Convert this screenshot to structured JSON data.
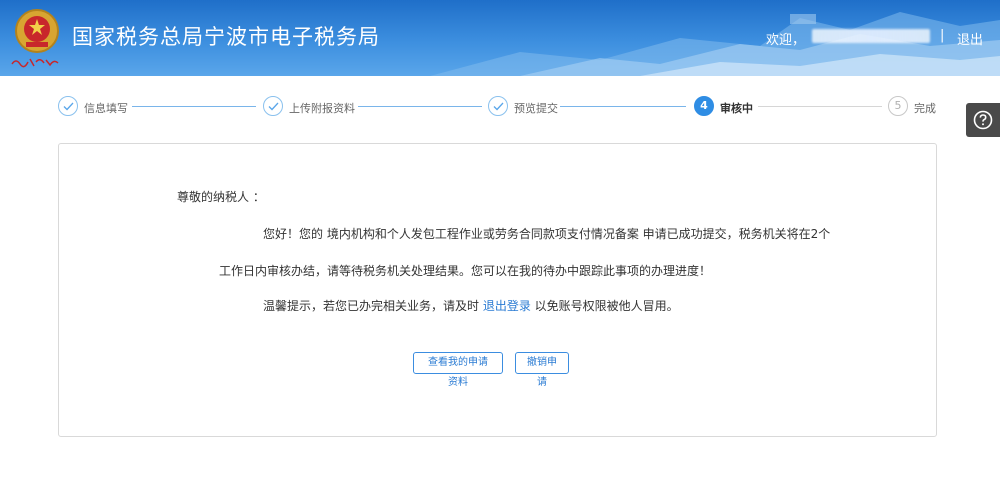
{
  "header": {
    "title": "国家税务总局宁波市电子税务局",
    "welcome": "欢迎，",
    "separator": "|",
    "logout": "退出"
  },
  "steps": [
    {
      "label": "信息填写",
      "status": "done"
    },
    {
      "label": "上传附报资料",
      "status": "done"
    },
    {
      "label": "预览提交",
      "status": "done"
    },
    {
      "number": "4",
      "label": "审核中",
      "status": "active"
    },
    {
      "number": "5",
      "label": "完成",
      "status": "pending"
    }
  ],
  "message": {
    "greeting": "尊敬的纳税人 ：",
    "line1_a": "您好！您的 ",
    "line1_b": "境内机构和个人发包工程作业或劳务合同款项支付情况备案",
    "line1_c": " 申请已成功提交，税务机关将在2个",
    "line2": "工作日内审核办结，请等待税务机关处理结果。您可以在我的待办中跟踪此事项的办理进度！",
    "line3_a": "温馨提示，若您已办完相关业务，请及时 ",
    "line3_link": "退出登录",
    "line3_b": " 以免账号权限被他人冒用。"
  },
  "buttons": {
    "view": "查看我的申请资料",
    "cancel": "撤销申请"
  },
  "colors": {
    "accent": "#2f8de4",
    "header": "#3d8fdf",
    "link": "#2a7bd3"
  },
  "icons": {
    "help": "question-circle-icon",
    "check": "check-icon",
    "emblem": "tax-emblem-icon"
  }
}
